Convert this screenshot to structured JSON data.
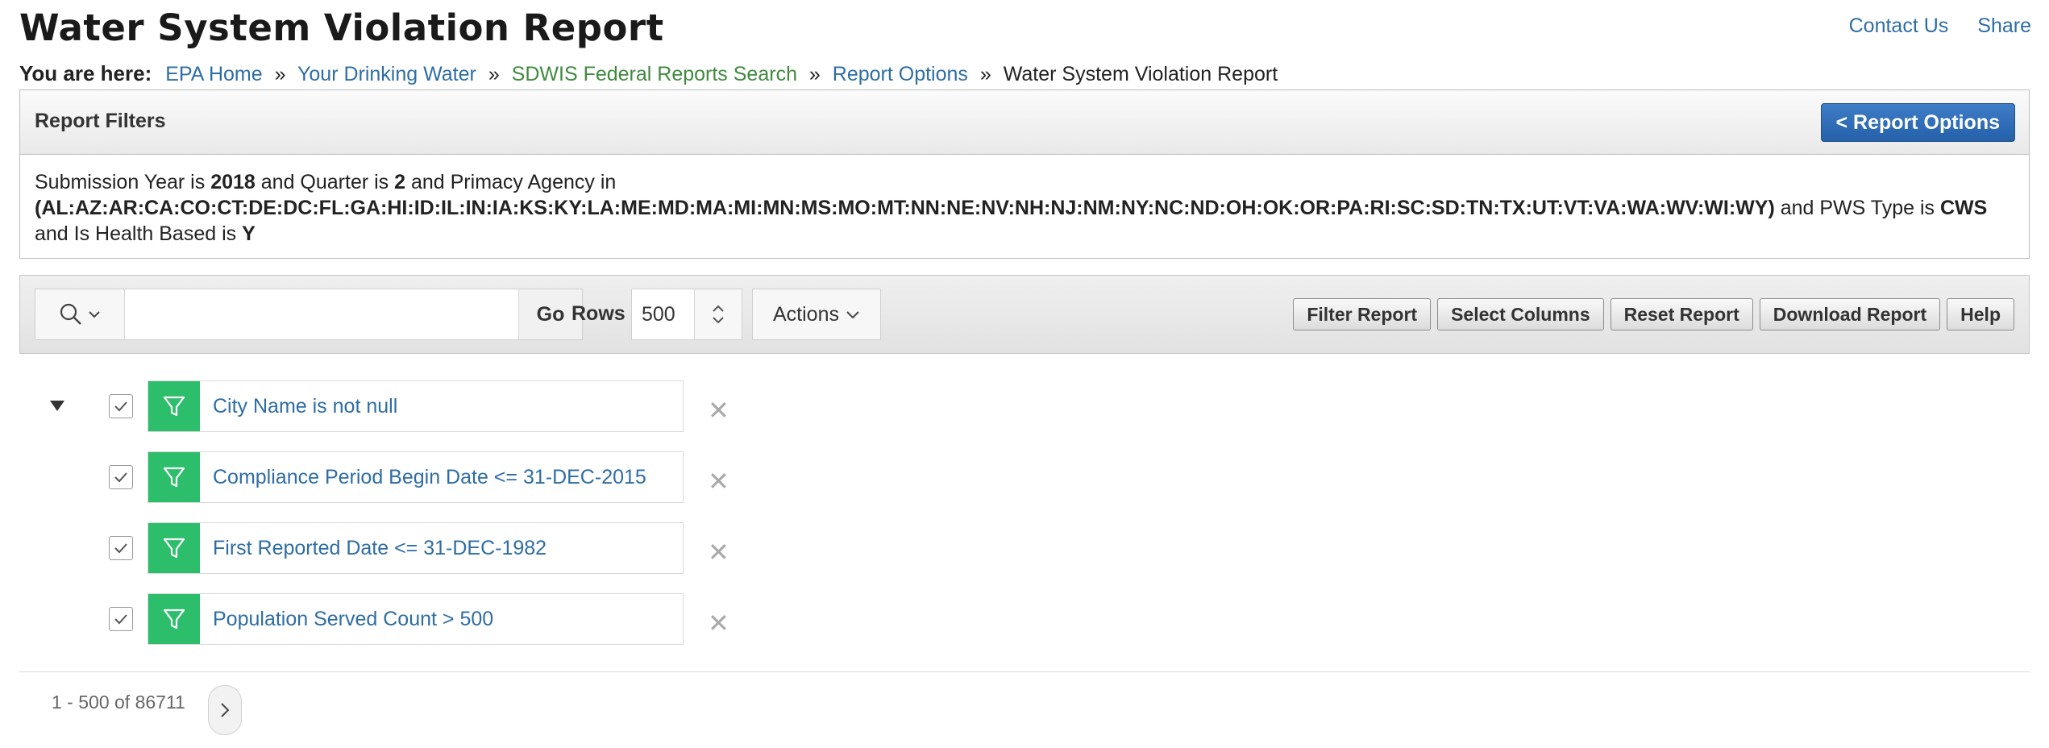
{
  "page": {
    "title": "Water System Violation Report"
  },
  "top_links": {
    "contact": "Contact Us",
    "share": "Share"
  },
  "breadcrumb": {
    "label": "You are here:",
    "items": [
      "EPA Home",
      "Your Drinking Water",
      "SDWIS Federal Reports Search",
      "Report Options"
    ],
    "separator": "»",
    "current": "Water System Violation Report"
  },
  "report_filters": {
    "title": "Report Filters",
    "back_button": "< Report Options",
    "t1": "Submission Year is ",
    "year": "2018",
    "t2": " and Quarter is ",
    "quarter": "2",
    "t3": " and Primacy Agency in ",
    "agencies": "(AL:AZ:AR:CA:CO:CT:DE:DC:FL:GA:HI:ID:IL:IN:IA:KS:KY:LA:ME:MD:MA:MI:MN:MS:MO:MT:NN:NE:NV:NH:NJ:NM:NY:NC:ND:OH:OK:OR:PA:RI:SC:SD:TN:TX:UT:VT:VA:WA:WV:WI:WY)",
    "t4": " and PWS Type is ",
    "pws_type": "CWS",
    "t5": " and Is Health Based is ",
    "health_based": "Y"
  },
  "toolbar": {
    "search_value": "",
    "go": "Go",
    "rows_label": "Rows",
    "rows_value": "500",
    "actions": "Actions",
    "buttons": [
      "Filter Report",
      "Select Columns",
      "Reset Report",
      "Download Report",
      "Help"
    ]
  },
  "applied_filters": [
    {
      "text": "City Name is not null",
      "checked": true
    },
    {
      "text": "Compliance Period Begin Date <= 31-DEC-2015",
      "checked": true
    },
    {
      "text": "First Reported Date <= 31-DEC-1982",
      "checked": true
    },
    {
      "text": "Population Served Count > 500",
      "checked": true
    }
  ],
  "pagination": {
    "range": "1 - 500 of 86711"
  },
  "colors": {
    "link": "#2e6da4",
    "filter_icon_bg": "#2dbe6c",
    "primary_button": "#2f6db8",
    "breadcrumb_green": "#3f8a3f"
  }
}
